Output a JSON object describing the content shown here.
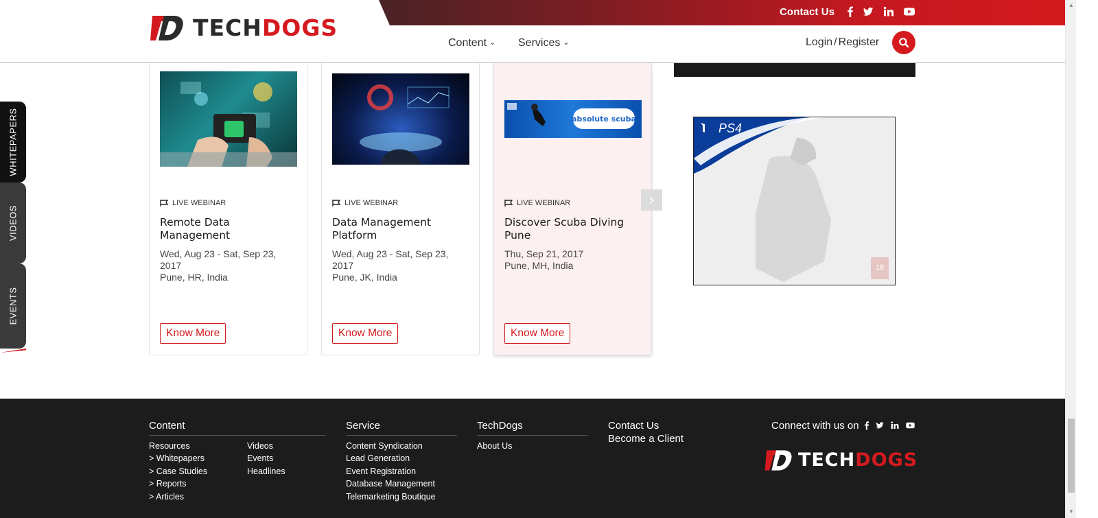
{
  "header": {
    "brand_part1": "TECH",
    "brand_part2": "DOGS",
    "contact_us": "Contact Us",
    "nav": [
      "Content",
      "Services"
    ],
    "login": "Login",
    "register": "Register",
    "login_sep": "/"
  },
  "side_tabs": [
    "WHITEPAPERS",
    "VIDEOS",
    "EVENTS"
  ],
  "cards": [
    {
      "tag": "LIVE WEBINAR",
      "title": "Remote Data Management",
      "dates": "Wed, Aug 23 - Sat, Sep 23, 2017",
      "location": "Pune, HR, India",
      "button": "Know More"
    },
    {
      "tag": "LIVE WEBINAR",
      "title": "Data Management Platform",
      "dates": "Wed, Aug 23 - Sat, Sep 23, 2017",
      "location": "Pune, JK, India",
      "button": "Know More"
    },
    {
      "tag": "LIVE WEBINAR",
      "title": "Discover Scuba Diving Pune",
      "dates": "Thu, Sep 21, 2017",
      "location": "Pune, MH, India",
      "button": "Know More",
      "banner_text": "absolute scuba"
    }
  ],
  "ad": {
    "label": "PS4",
    "rating": "18"
  },
  "footer": {
    "content": {
      "heading": "Content",
      "col1": [
        "Resources",
        "> Whitepapers",
        "> Case Studies",
        "> Reports",
        "> Articles"
      ],
      "col2": [
        "Videos",
        "Events",
        "Headlines"
      ]
    },
    "service": {
      "heading": "Service",
      "links": [
        "Content Syndication",
        "Lead Generation",
        "Event Registration",
        "Database Management",
        "Telemarketing Boutique"
      ]
    },
    "techdogs": {
      "heading": "TechDogs",
      "links": [
        "About Us"
      ]
    },
    "contact": [
      "Contact Us",
      "Become a Client"
    ],
    "connect": "Connect with us on",
    "brand_part1": "TECH",
    "brand_part2": "DOGS"
  },
  "colors": {
    "brand_red": "#d41a1f",
    "footer_bg": "#1c1c1c",
    "active_card_bg": "#fdf0f0"
  }
}
